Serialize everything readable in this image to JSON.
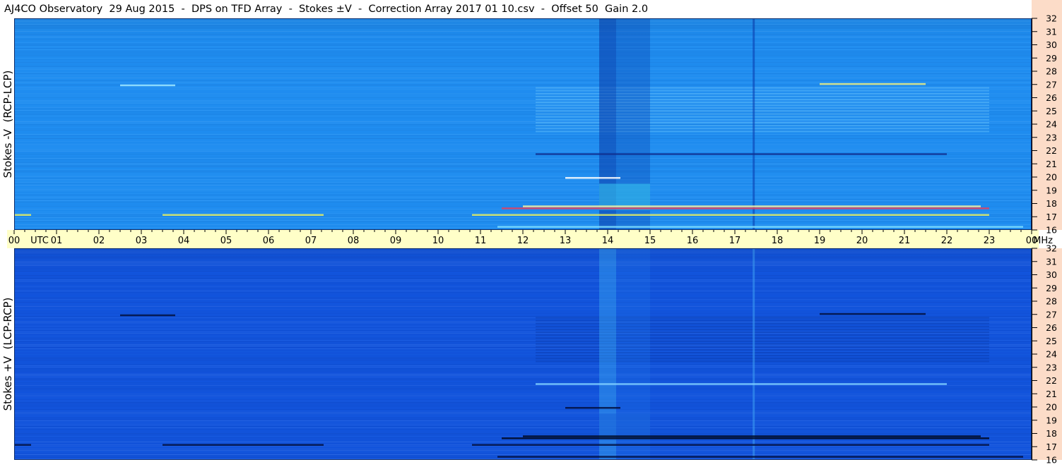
{
  "title": "AJ4CO Observatory  29 Aug 2015  -  DPS on TFD Array  -  Stokes ±V  -  Correction Array 2017 01 10.csv  -  Offset 50  Gain 2.0",
  "colors": {
    "top_panel_base": "#1f8df0",
    "bottom_panel_base": "#1254dc",
    "time_strip_bg": "#ffffc8",
    "freq_strip_bg": "#fcdcc8",
    "hot_line_yellow": "#e8f060",
    "hot_line_red": "#e04060",
    "cyan_band": "#38c8f0",
    "dark_band": "#0a2a8a"
  },
  "chart_data": [
    {
      "type": "heatmap",
      "panel": "top",
      "ylabel": "Stokes -V  (RCP-LCP)",
      "x_axis": {
        "label": "UTC",
        "ticks": [
          "00",
          "01",
          "02",
          "03",
          "04",
          "05",
          "06",
          "07",
          "08",
          "09",
          "10",
          "11",
          "12",
          "13",
          "14",
          "15",
          "16",
          "17",
          "18",
          "19",
          "20",
          "21",
          "22",
          "23",
          "00"
        ],
        "range_hours": [
          0,
          24
        ]
      },
      "y_axis": {
        "label": "MHz",
        "ticks": [
          "16",
          "17",
          "18",
          "19",
          "20",
          "21",
          "22",
          "23",
          "24",
          "25",
          "26",
          "27",
          "28",
          "29",
          "30",
          "31",
          "32"
        ],
        "range_mhz": [
          16,
          32
        ]
      },
      "features": {
        "bright_bands_utc": [
          [
            13.8,
            14.2
          ],
          [
            14.2,
            15.0
          ]
        ],
        "interference_freqs_mhz": [
          17.2,
          17.8,
          18.0,
          27.0
        ],
        "burst_window_utc": [
          11.0,
          23.0
        ]
      }
    },
    {
      "type": "heatmap",
      "panel": "bottom",
      "ylabel": "Stokes +V  (LCP-RCP)",
      "x_axis": {
        "label": "UTC",
        "ticks": [
          "00",
          "01",
          "02",
          "03",
          "04",
          "05",
          "06",
          "07",
          "08",
          "09",
          "10",
          "11",
          "12",
          "13",
          "14",
          "15",
          "16",
          "17",
          "18",
          "19",
          "20",
          "21",
          "22",
          "23",
          "00"
        ],
        "range_hours": [
          0,
          24
        ]
      },
      "y_axis": {
        "label": "MHz",
        "ticks": [
          "16",
          "17",
          "18",
          "19",
          "20",
          "21",
          "22",
          "23",
          "24",
          "25",
          "26",
          "27",
          "28",
          "29",
          "30",
          "31",
          "32"
        ],
        "range_mhz": [
          16,
          32
        ]
      }
    }
  ]
}
